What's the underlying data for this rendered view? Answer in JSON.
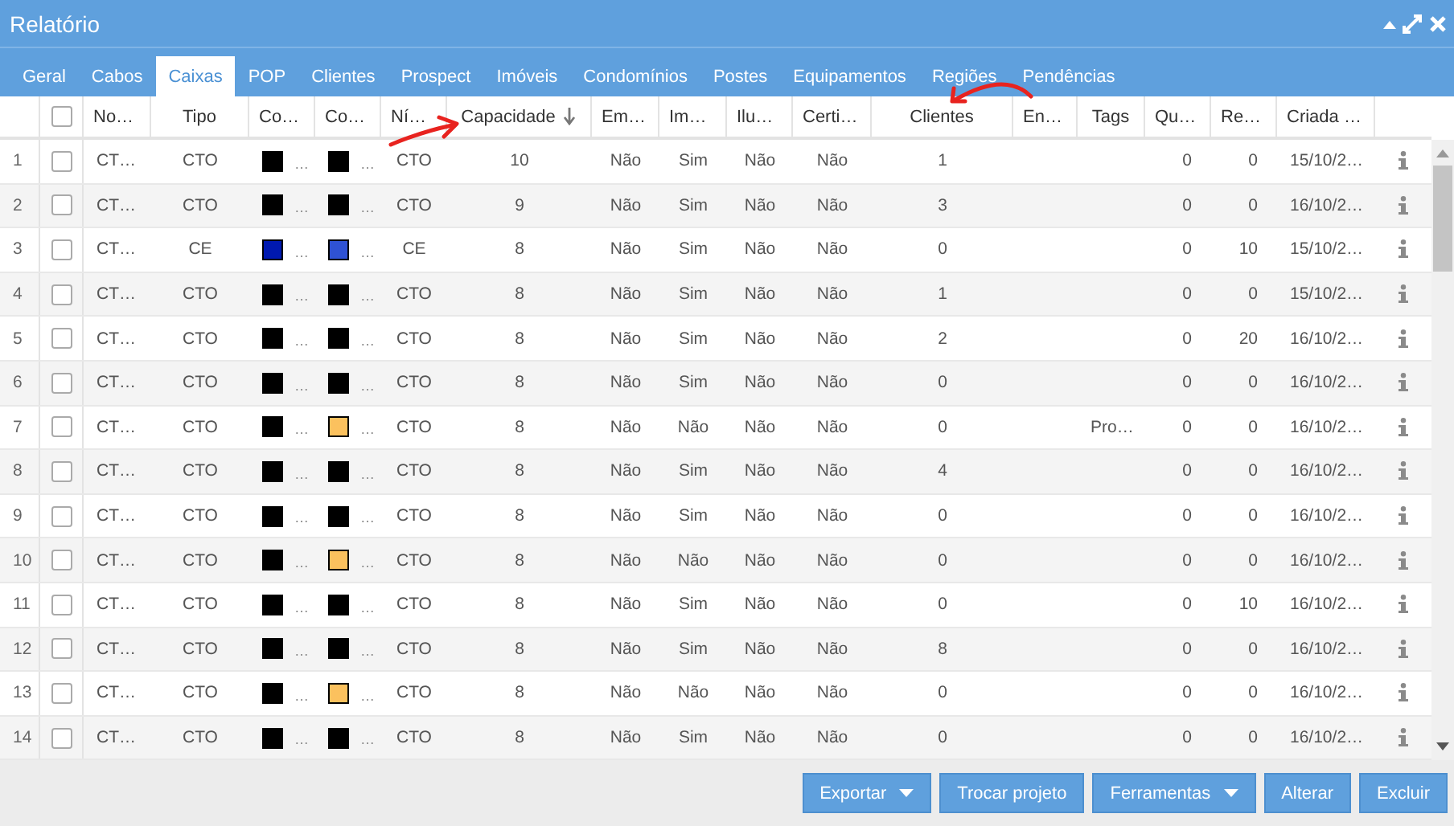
{
  "window": {
    "title": "Relatório"
  },
  "tabs": [
    {
      "label": "Geral",
      "selected": false
    },
    {
      "label": "Cabos",
      "selected": false
    },
    {
      "label": "Caixas",
      "selected": true
    },
    {
      "label": "POP",
      "selected": false
    },
    {
      "label": "Clientes",
      "selected": false
    },
    {
      "label": "Prospect",
      "selected": false
    },
    {
      "label": "Imóveis",
      "selected": false
    },
    {
      "label": "Condomínios",
      "selected": false
    },
    {
      "label": "Postes",
      "selected": false
    },
    {
      "label": "Equipamentos",
      "selected": false
    },
    {
      "label": "Regiões",
      "selected": false
    },
    {
      "label": "Pendências",
      "selected": false
    }
  ],
  "table": {
    "select_all": {
      "checked": false
    },
    "columns": [
      {
        "label": "No…",
        "kind": "text",
        "sorted": false
      },
      {
        "label": "Tipo",
        "kind": "text",
        "sorted": false
      },
      {
        "label": "Co…",
        "kind": "swatch",
        "sorted": false
      },
      {
        "label": "Co…",
        "kind": "swatch",
        "sorted": false
      },
      {
        "label": "Ní…",
        "kind": "text",
        "sorted": false
      },
      {
        "label": "Capacidade",
        "kind": "text",
        "sorted": true
      },
      {
        "label": "Em…",
        "kind": "text",
        "sorted": false
      },
      {
        "label": "Im…",
        "kind": "text",
        "sorted": false
      },
      {
        "label": "Ilu…",
        "kind": "text",
        "sorted": false
      },
      {
        "label": "Certi…",
        "kind": "text",
        "sorted": false
      },
      {
        "label": "Clientes",
        "kind": "text",
        "sorted": false
      },
      {
        "label": "En…",
        "kind": "text",
        "sorted": false
      },
      {
        "label": "Tags",
        "kind": "text",
        "sorted": false
      },
      {
        "label": "Qu…",
        "kind": "text",
        "sorted": false
      },
      {
        "label": "Re…",
        "kind": "text",
        "sorted": false
      },
      {
        "label": "Criada …",
        "kind": "text",
        "sorted": false
      }
    ],
    "rows": [
      {
        "number": "1",
        "checked": false,
        "cells": [
          "CT…",
          "CTO",
          {
            "color": "#000000",
            "text": "…"
          },
          {
            "color": "#000000",
            "text": "…"
          },
          "CTO",
          "10",
          "Não",
          "Sim",
          "Não",
          "Não",
          "1",
          "",
          "",
          "0",
          "0",
          "15/10/2…"
        ]
      },
      {
        "number": "2",
        "checked": false,
        "cells": [
          "CT…",
          "CTO",
          {
            "color": "#000000",
            "text": "…"
          },
          {
            "color": "#000000",
            "text": "…"
          },
          "CTO",
          "9",
          "Não",
          "Sim",
          "Não",
          "Não",
          "3",
          "",
          "",
          "0",
          "0",
          "16/10/2…"
        ]
      },
      {
        "number": "3",
        "checked": false,
        "cells": [
          "CT…",
          "CE",
          {
            "color": "#0019b0",
            "text": "…"
          },
          {
            "color": "#2f52d4",
            "text": "…"
          },
          "CE",
          "8",
          "Não",
          "Sim",
          "Não",
          "Não",
          "0",
          "",
          "",
          "0",
          "10",
          "15/10/2…"
        ]
      },
      {
        "number": "4",
        "checked": false,
        "cells": [
          "CT…",
          "CTO",
          {
            "color": "#000000",
            "text": "…"
          },
          {
            "color": "#000000",
            "text": "…"
          },
          "CTO",
          "8",
          "Não",
          "Sim",
          "Não",
          "Não",
          "1",
          "",
          "",
          "0",
          "0",
          "15/10/2…"
        ]
      },
      {
        "number": "5",
        "checked": false,
        "cells": [
          "CT…",
          "CTO",
          {
            "color": "#000000",
            "text": "…"
          },
          {
            "color": "#000000",
            "text": "…"
          },
          "CTO",
          "8",
          "Não",
          "Sim",
          "Não",
          "Não",
          "2",
          "",
          "",
          "0",
          "20",
          "16/10/2…"
        ]
      },
      {
        "number": "6",
        "checked": false,
        "cells": [
          "CT…",
          "CTO",
          {
            "color": "#000000",
            "text": "…"
          },
          {
            "color": "#000000",
            "text": "…"
          },
          "CTO",
          "8",
          "Não",
          "Sim",
          "Não",
          "Não",
          "0",
          "",
          "",
          "0",
          "0",
          "16/10/2…"
        ]
      },
      {
        "number": "7",
        "checked": false,
        "cells": [
          "CT…",
          "CTO",
          {
            "color": "#000000",
            "text": "…"
          },
          {
            "color": "#fbc15e",
            "text": "…"
          },
          "CTO",
          "8",
          "Não",
          "Não",
          "Não",
          "Não",
          "0",
          "",
          "Pro…",
          "0",
          "0",
          "16/10/2…"
        ]
      },
      {
        "number": "8",
        "checked": false,
        "cells": [
          "CT…",
          "CTO",
          {
            "color": "#000000",
            "text": "…"
          },
          {
            "color": "#000000",
            "text": "…"
          },
          "CTO",
          "8",
          "Não",
          "Sim",
          "Não",
          "Não",
          "4",
          "",
          "",
          "0",
          "0",
          "16/10/2…"
        ]
      },
      {
        "number": "9",
        "checked": false,
        "cells": [
          "CT…",
          "CTO",
          {
            "color": "#000000",
            "text": "…"
          },
          {
            "color": "#000000",
            "text": "…"
          },
          "CTO",
          "8",
          "Não",
          "Sim",
          "Não",
          "Não",
          "0",
          "",
          "",
          "0",
          "0",
          "16/10/2…"
        ]
      },
      {
        "number": "10",
        "checked": false,
        "cells": [
          "CT…",
          "CTO",
          {
            "color": "#000000",
            "text": "…"
          },
          {
            "color": "#fbc15e",
            "text": "…"
          },
          "CTO",
          "8",
          "Não",
          "Não",
          "Não",
          "Não",
          "0",
          "",
          "",
          "0",
          "0",
          "16/10/2…"
        ]
      },
      {
        "number": "11",
        "checked": false,
        "cells": [
          "CT…",
          "CTO",
          {
            "color": "#000000",
            "text": "…"
          },
          {
            "color": "#000000",
            "text": "…"
          },
          "CTO",
          "8",
          "Não",
          "Sim",
          "Não",
          "Não",
          "0",
          "",
          "",
          "0",
          "10",
          "16/10/2…"
        ]
      },
      {
        "number": "12",
        "checked": false,
        "cells": [
          "CT…",
          "CTO",
          {
            "color": "#000000",
            "text": "…"
          },
          {
            "color": "#000000",
            "text": "…"
          },
          "CTO",
          "8",
          "Não",
          "Sim",
          "Não",
          "Não",
          "8",
          "",
          "",
          "0",
          "0",
          "16/10/2…"
        ]
      },
      {
        "number": "13",
        "checked": false,
        "cells": [
          "CT…",
          "CTO",
          {
            "color": "#000000",
            "text": "…"
          },
          {
            "color": "#fbc15e",
            "text": "…"
          },
          "CTO",
          "8",
          "Não",
          "Não",
          "Não",
          "Não",
          "0",
          "",
          "",
          "0",
          "0",
          "16/10/2…"
        ]
      },
      {
        "number": "14",
        "checked": false,
        "cells": [
          "CT…",
          "CTO",
          {
            "color": "#000000",
            "text": "…"
          },
          {
            "color": "#000000",
            "text": "…"
          },
          "CTO",
          "8",
          "Não",
          "Sim",
          "Não",
          "Não",
          "0",
          "",
          "",
          "0",
          "0",
          "16/10/2…"
        ]
      }
    ]
  },
  "buttons": [
    {
      "label": "Exportar",
      "dropdown": true
    },
    {
      "label": "Trocar projeto",
      "dropdown": false
    },
    {
      "label": "Ferramentas",
      "dropdown": true
    },
    {
      "label": "Alterar",
      "dropdown": false
    },
    {
      "label": "Excluir",
      "dropdown": false
    }
  ]
}
